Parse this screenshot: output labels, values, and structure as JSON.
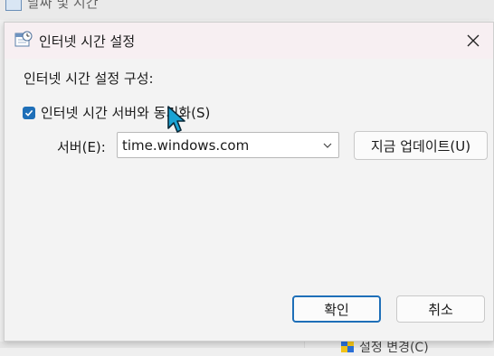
{
  "background_window": {
    "title": "날짜 및 시간",
    "partial_link": "설정 변경(C)"
  },
  "dialog": {
    "title": "인터넷 시간 설정",
    "section_label": "인터넷 시간 설정 구성:",
    "sync_checkbox": {
      "label": "인터넷 시간 서버와 동기화(S)",
      "checked": true
    },
    "server": {
      "label": "서버(E):",
      "value": "time.windows.com"
    },
    "update_button": "지금 업데이트(U)",
    "ok_button": "확인",
    "cancel_button": "취소"
  },
  "colors": {
    "accent": "#1e6fb8",
    "titlebar": "#f7eff2",
    "dialog_bg": "#f3f3f3"
  },
  "icons": [
    "calendar-clock-icon",
    "close-icon",
    "checkmark-icon",
    "chevron-down-icon",
    "shield-icon",
    "mouse-pointer-icon"
  ]
}
